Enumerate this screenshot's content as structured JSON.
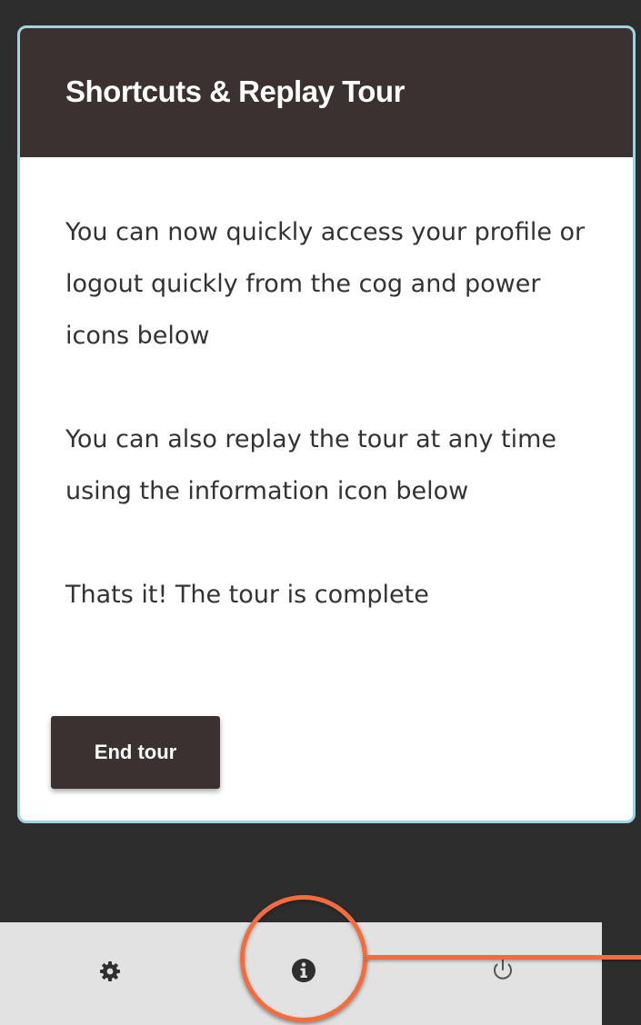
{
  "popover": {
    "title": "Shortcuts & Replay Tour",
    "paragraphs": [
      "You can now quickly access your profile or logout quickly from the cog and power icons below",
      "You can also replay the tour at any time using the information icon below",
      "Thats it! The tour is complete"
    ],
    "end_tour_label": "End tour"
  },
  "bottom_bar": {
    "icons": [
      "cog-icon",
      "info-icon",
      "power-icon"
    ]
  },
  "colors": {
    "header_bg": "#3a3130",
    "popover_border": "#9fd6de",
    "highlight": "#f26c3d",
    "bar_bg": "#e2e2e2",
    "backdrop": "#2d2d2d"
  }
}
